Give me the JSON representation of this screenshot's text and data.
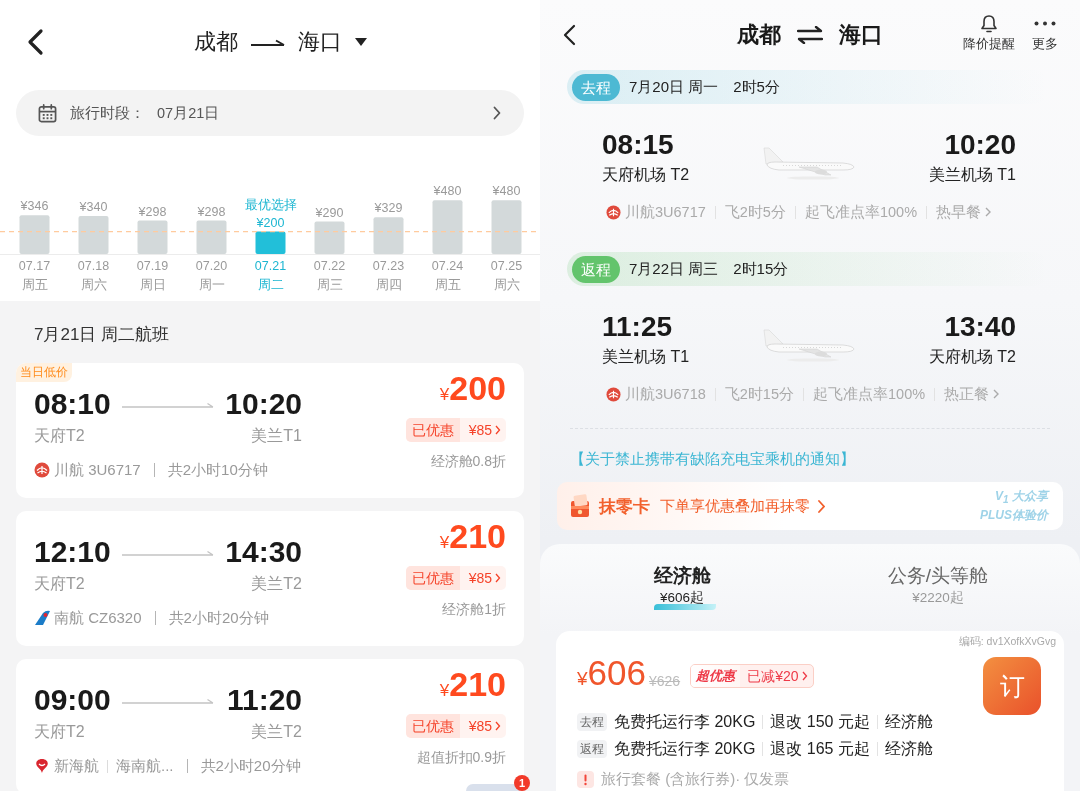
{
  "left_screen": {
    "header": {
      "origin": "成都",
      "destination": "海口"
    },
    "date_bar": {
      "label": "旅行时段：",
      "value": "07月21日"
    },
    "price_calendar": {
      "chart_data": [
        {
          "type": "bar",
          "categories": [
            "07.17",
            "07.18",
            "07.19",
            "07.20",
            "07.21",
            "07.22",
            "07.23",
            "07.24",
            "07.25"
          ],
          "values": [
            346,
            340,
            298,
            298,
            200,
            290,
            329,
            480,
            480
          ],
          "value_labels": [
            "¥346",
            "¥340",
            "¥298",
            "¥298",
            "¥200",
            "¥290",
            "¥329",
            "¥480",
            "¥480"
          ],
          "colors": [
            "#d3d9da",
            "#d3d9da",
            "#d3d9da",
            "#d3d9da",
            "#22bfd9",
            "#d3d9da",
            "#d3d9da",
            "#d3d9da",
            "#d3d9da"
          ],
          "ylim": [
            0,
            500
          ],
          "tick_labels": "x",
          "ref_lines": [
            {
              "axis": "y",
              "value": 200,
              "color": "#ffcb9e",
              "line_style": "dashed"
            }
          ],
          "annotations": [
            "最优选择"
          ]
        }
      ],
      "days": [
        {
          "weekday": "周五",
          "selected": false
        },
        {
          "weekday": "周六",
          "selected": false
        },
        {
          "weekday": "周日",
          "selected": false
        },
        {
          "weekday": "周一",
          "selected": false
        },
        {
          "weekday": "周二",
          "selected": true
        },
        {
          "weekday": "周三",
          "selected": false
        },
        {
          "weekday": "周四",
          "selected": false
        },
        {
          "weekday": "周五",
          "selected": false
        },
        {
          "weekday": "周六",
          "selected": false
        }
      ]
    },
    "section_title": "7月21日 周二航班",
    "flights": [
      {
        "tag": "当日低价",
        "depart_time": "08:10",
        "arrive_time": "10:20",
        "depart_airport": "天府T2",
        "arrive_airport": "美兰T1",
        "kind": "roundel",
        "carriers": [
          "川航 3U6717"
        ],
        "duration": "共2小时10分钟",
        "currency": "¥",
        "price": "200",
        "discount_label": "已优惠",
        "discount": "¥85",
        "fare_note": "经济舱0.8折"
      },
      {
        "depart_time": "12:10",
        "arrive_time": "14:30",
        "depart_airport": "天府T2",
        "arrive_airport": "美兰T2",
        "kind": "tail",
        "carriers": [
          "南航 CZ6320"
        ],
        "duration": "共2小时20分钟",
        "currency": "¥",
        "price": "210",
        "discount_label": "已优惠",
        "discount": "¥85",
        "fare_note": "经济舱1折"
      },
      {
        "depart_time": "09:00",
        "arrive_time": "11:20",
        "depart_airport": "天府T2",
        "arrive_airport": "美兰T2",
        "kind": "emblem",
        "carriers": [
          "新海航",
          "海南航..."
        ],
        "duration": "共2小时20分钟",
        "currency": "¥",
        "price": "210",
        "discount_label": "已优惠",
        "discount": "¥85",
        "fare_note": "超值折扣0.9折"
      }
    ],
    "floating_badge": "1"
  },
  "right_screen": {
    "header": {
      "origin": "成都",
      "destination": "海口",
      "actions": [
        {
          "kind": "bell",
          "label": "降价提醒"
        },
        {
          "kind": "more",
          "label": "更多"
        }
      ]
    },
    "legs": [
      {
        "label": "去程",
        "color": "#4db9d3",
        "date": "7月20日 周一",
        "duration": "2时5分",
        "depart_time": "08:15",
        "depart_airport": "天府机场 T2",
        "arrive_time": "10:20",
        "arrive_airport": "美兰机场 T1",
        "details": [
          "川航3U6717",
          "飞2时5分",
          "起飞准点率100%",
          "热早餐"
        ]
      },
      {
        "label": "返程",
        "color": "#63c46c",
        "date": "7月22日 周三",
        "duration": "2时15分",
        "depart_time": "11:25",
        "depart_airport": "美兰机场 T1",
        "arrive_time": "13:40",
        "arrive_airport": "天府机场 T2",
        "details": [
          "川航3U6718",
          "飞2时15分",
          "起飞准点率100%",
          "热正餐"
        ]
      }
    ],
    "notice": "【关于禁止携带有缺陷充电宝乘机的通知】",
    "promo": {
      "title": "抹零卡",
      "text": "下单享优惠叠加再抹零",
      "badge_lines": [
        "V$_{1}$ 大众享",
        "PLUS体验价"
      ]
    },
    "cabin_tabs": [
      {
        "label": "经济舱",
        "price": "¥606起",
        "selected": true
      },
      {
        "label": "公务/头等舱",
        "price": "¥2220起",
        "selected": false
      }
    ],
    "fare": {
      "code": "编码: dv1XofkXvGvg",
      "currency": "¥",
      "price": "606",
      "original_price": "¥626",
      "promo_tag": "超优惠",
      "promo_value": "已减¥20",
      "book_label": "订",
      "rules": [
        {
          "leg": "去程",
          "items": [
            "免费托运行李 20KG",
            "退改 150 元起",
            "经济舱"
          ]
        },
        {
          "leg": "返程",
          "items": [
            "免费托运行李 20KG",
            "退改 165 元起",
            "经济舱"
          ]
        }
      ],
      "note": "旅行套餐 (含旅行券)· 仅发票"
    }
  }
}
